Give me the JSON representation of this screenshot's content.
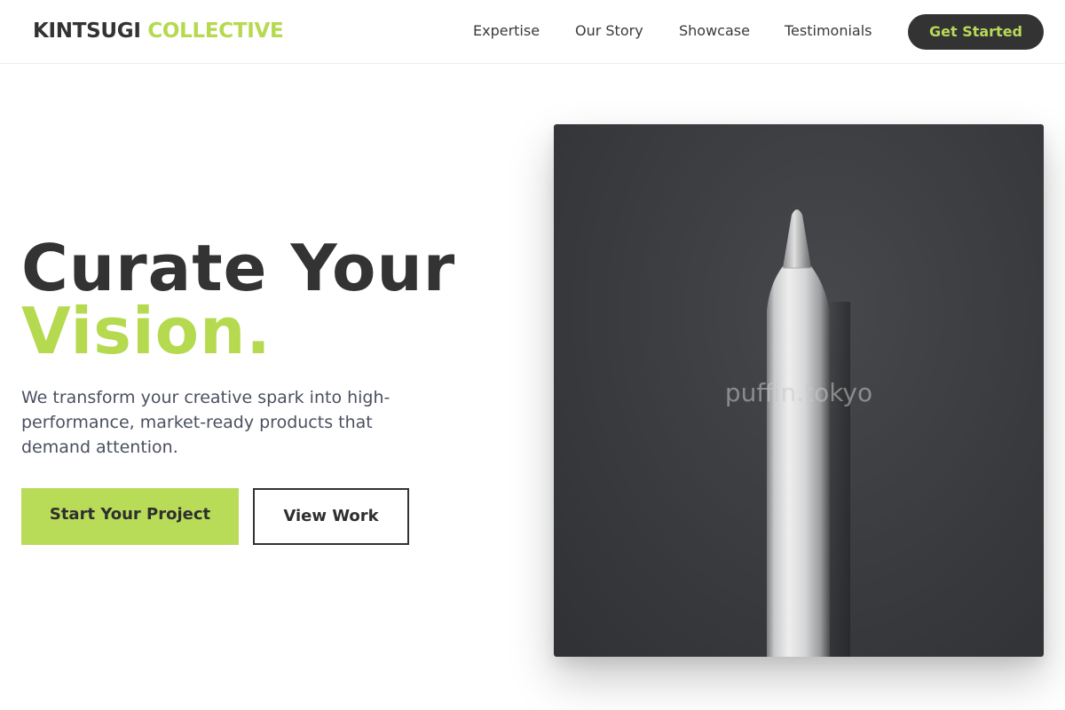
{
  "header": {
    "logo_part1": "KINTSUGI",
    "logo_part2": "COLLECTIVE",
    "nav": [
      "Expertise",
      "Our Story",
      "Showcase",
      "Testimonials"
    ],
    "cta_label": "Get Started"
  },
  "hero": {
    "title_line1": "Curate Your",
    "title_line2": "Vision.",
    "subtitle": "We transform your creative spark into high-performance, market-ready products that demand attention.",
    "primary_button": "Start Your Project",
    "secondary_button": "View Work",
    "image_watermark": "puffin.tokyo"
  },
  "colors": {
    "accent": "#b5d94f",
    "dark": "#333333",
    "text_muted": "#4a5060",
    "image_bg": "#3a3b3e"
  }
}
